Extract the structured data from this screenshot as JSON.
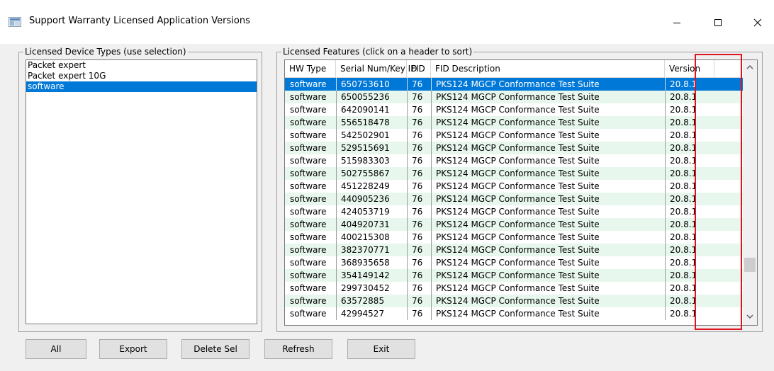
{
  "window": {
    "title": "Support Warranty Licensed Application Versions",
    "minimize_glyph": "—",
    "maximize_glyph": "☐",
    "close_glyph": "✕"
  },
  "device_group": {
    "label": "Licensed Device Types (use selection)",
    "items": [
      {
        "label": "Packet expert",
        "selected": false
      },
      {
        "label": "Packet expert 10G",
        "selected": false
      },
      {
        "label": "software",
        "selected": true
      }
    ]
  },
  "features_group": {
    "label": "Licensed Features   (click on a header to sort)",
    "columns": [
      "HW Type",
      "Serial Num/Key ID",
      "FID",
      "FID Description",
      "Version"
    ],
    "rows": [
      [
        "software",
        "650753610",
        "76",
        "PKS124 MGCP Conformance Test Suite",
        "20.8.1"
      ],
      [
        "software",
        "650055236",
        "76",
        "PKS124 MGCP Conformance Test Suite",
        "20.8.1"
      ],
      [
        "software",
        "642090141",
        "76",
        "PKS124 MGCP Conformance Test Suite",
        "20.8.1"
      ],
      [
        "software",
        "556518478",
        "76",
        "PKS124 MGCP Conformance Test Suite",
        "20.8.1"
      ],
      [
        "software",
        "542502901",
        "76",
        "PKS124 MGCP Conformance Test Suite",
        "20.8.1"
      ],
      [
        "software",
        "529515691",
        "76",
        "PKS124 MGCP Conformance Test Suite",
        "20.8.1"
      ],
      [
        "software",
        "515983303",
        "76",
        "PKS124 MGCP Conformance Test Suite",
        "20.8.1"
      ],
      [
        "software",
        "502755867",
        "76",
        "PKS124 MGCP Conformance Test Suite",
        "20.8.1"
      ],
      [
        "software",
        "451228249",
        "76",
        "PKS124 MGCP Conformance Test Suite",
        "20.8.1"
      ],
      [
        "software",
        "440905236",
        "76",
        "PKS124 MGCP Conformance Test Suite",
        "20.8.1"
      ],
      [
        "software",
        "424053719",
        "76",
        "PKS124 MGCP Conformance Test Suite",
        "20.8.1"
      ],
      [
        "software",
        "404920731",
        "76",
        "PKS124 MGCP Conformance Test Suite",
        "20.8.1"
      ],
      [
        "software",
        "400215308",
        "76",
        "PKS124 MGCP Conformance Test Suite",
        "20.8.1"
      ],
      [
        "software",
        "382370771",
        "76",
        "PKS124 MGCP Conformance Test Suite",
        "20.8.1"
      ],
      [
        "software",
        "368935658",
        "76",
        "PKS124 MGCP Conformance Test Suite",
        "20.8.1"
      ],
      [
        "software",
        "354149142",
        "76",
        "PKS124 MGCP Conformance Test Suite",
        "20.8.1"
      ],
      [
        "software",
        "299730452",
        "76",
        "PKS124 MGCP Conformance Test Suite",
        "20.8.1"
      ],
      [
        "software",
        "63572885",
        "76",
        "PKS124 MGCP Conformance Test Suite",
        "20.8.1"
      ],
      [
        "software",
        "42994527",
        "76",
        "PKS124 MGCP Conformance Test Suite",
        "20.8.1"
      ]
    ],
    "selected_row": 0
  },
  "buttons": {
    "all": "All",
    "export": "Export",
    "delete_sel": "Delete Sel",
    "refresh": "Refresh",
    "exit": "Exit"
  },
  "colors": {
    "selection": "#0078d7",
    "alt_row": "#e8f7ee",
    "highlight_box": "#e0141e"
  }
}
